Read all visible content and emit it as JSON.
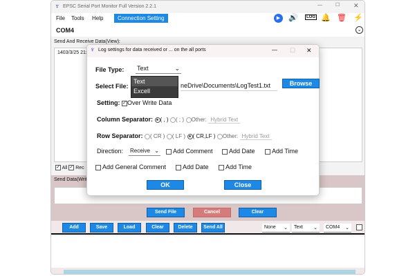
{
  "window": {
    "title": "EPSC Serial Port Monitor Full Version 2.2.1",
    "port": "COM4"
  },
  "menu": {
    "items": [
      "File",
      "Tools",
      "Help"
    ],
    "connection": "Connection Setting"
  },
  "toolbar_icons": [
    "play-icon",
    "speaker-icon",
    "log-icon",
    "alarm-icon",
    "trash-icon",
    "plug-icon"
  ],
  "view": {
    "label": "Send And Receive Data(View):",
    "first_line": "1403/3/25 21:2",
    "chk_all": "All",
    "chk_rec": "Rec"
  },
  "send": {
    "label": "Send Data(Write",
    "send_file": "Send File",
    "cancel": "Cancel",
    "clear": "Clear"
  },
  "bottom": {
    "buttons": [
      "Add",
      "Save",
      "Load",
      "Clear",
      "Delete",
      "Send All"
    ],
    "sel1": "None",
    "sel2": "Text",
    "sel3": "COM4"
  },
  "dialog": {
    "title": "Log settings for data received or ... on the all ports",
    "file_type_label": "File Type:",
    "file_type": "Text",
    "options": [
      "Text",
      "Excell"
    ],
    "select_file_label": "Select File:",
    "file_path": "neDrive\\Documents\\LogTest1.txt",
    "browse": "Browse",
    "setting_label": "Setting:",
    "overwrite": "Over Write Data",
    "col_sep_label": "Column Separator:",
    "col_opts": [
      "( , )",
      "( ; )",
      "Other:"
    ],
    "col_hybrid": "Hybrid Text",
    "row_sep_label": "Row Separator:",
    "row_opts": [
      "( CR )",
      "( LF )",
      "( CR,LF )",
      "Other:"
    ],
    "row_hybrid": "Hybrid Text",
    "direction_label": "Direction:",
    "direction": "Receive",
    "add_comment": "Add Comment",
    "add_date": "Add Date",
    "add_time": "Add Time",
    "add_general": "Add General Comment",
    "add_date2": "Add Date",
    "add_time2": "Add Time",
    "ok": "OK",
    "close": "Close"
  },
  "colors": {
    "accent": "#1e88e5",
    "cancel": "#d67b7b",
    "send_bg": "#d9c6c6"
  }
}
